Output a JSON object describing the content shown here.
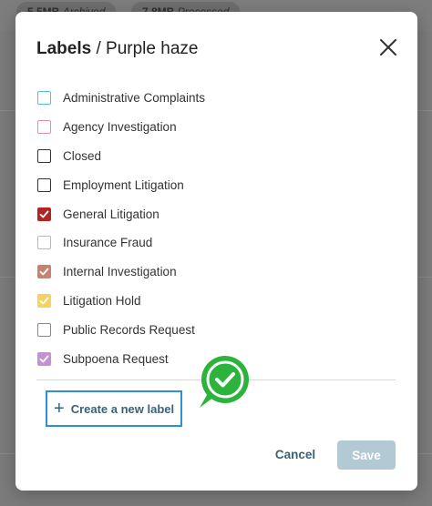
{
  "background": {
    "pills": [
      {
        "size": "5.5MB",
        "status": "Archived"
      },
      {
        "size": "7.8MB",
        "status": "Processed"
      }
    ]
  },
  "modal": {
    "title_bold": "Labels",
    "title_separator": "/",
    "title_name": "Purple haze",
    "close_icon": "close-icon",
    "labels": [
      {
        "name": "Administrative Complaints",
        "color": "#5bc0c9",
        "checked": false
      },
      {
        "name": "Agency Investigation",
        "color": "#e68bae",
        "checked": false
      },
      {
        "name": "Closed",
        "color": "#333333",
        "checked": false
      },
      {
        "name": "Employment Litigation",
        "color": "#333333",
        "checked": false
      },
      {
        "name": "General Litigation",
        "color": "#b22424",
        "checked": true
      },
      {
        "name": "Insurance Fraud",
        "color": "#8fe060",
        "checked": false
      },
      {
        "name": "Internal Investigation",
        "color": "#c98170",
        "checked": true
      },
      {
        "name": "Litigation Hold",
        "color": "#f6d35d",
        "checked": true
      },
      {
        "name": "Public Records Request",
        "color": "#3fa6ad",
        "checked": false
      },
      {
        "name": "Subpoena Request",
        "color": "#c690d6",
        "checked": true
      }
    ],
    "create_label": "Create a new label",
    "create_icon": "plus-icon",
    "badge_icon": "checkmark-badge-icon",
    "badge_color": "#2bb33c",
    "cancel_label": "Cancel",
    "save_label": "Save"
  }
}
